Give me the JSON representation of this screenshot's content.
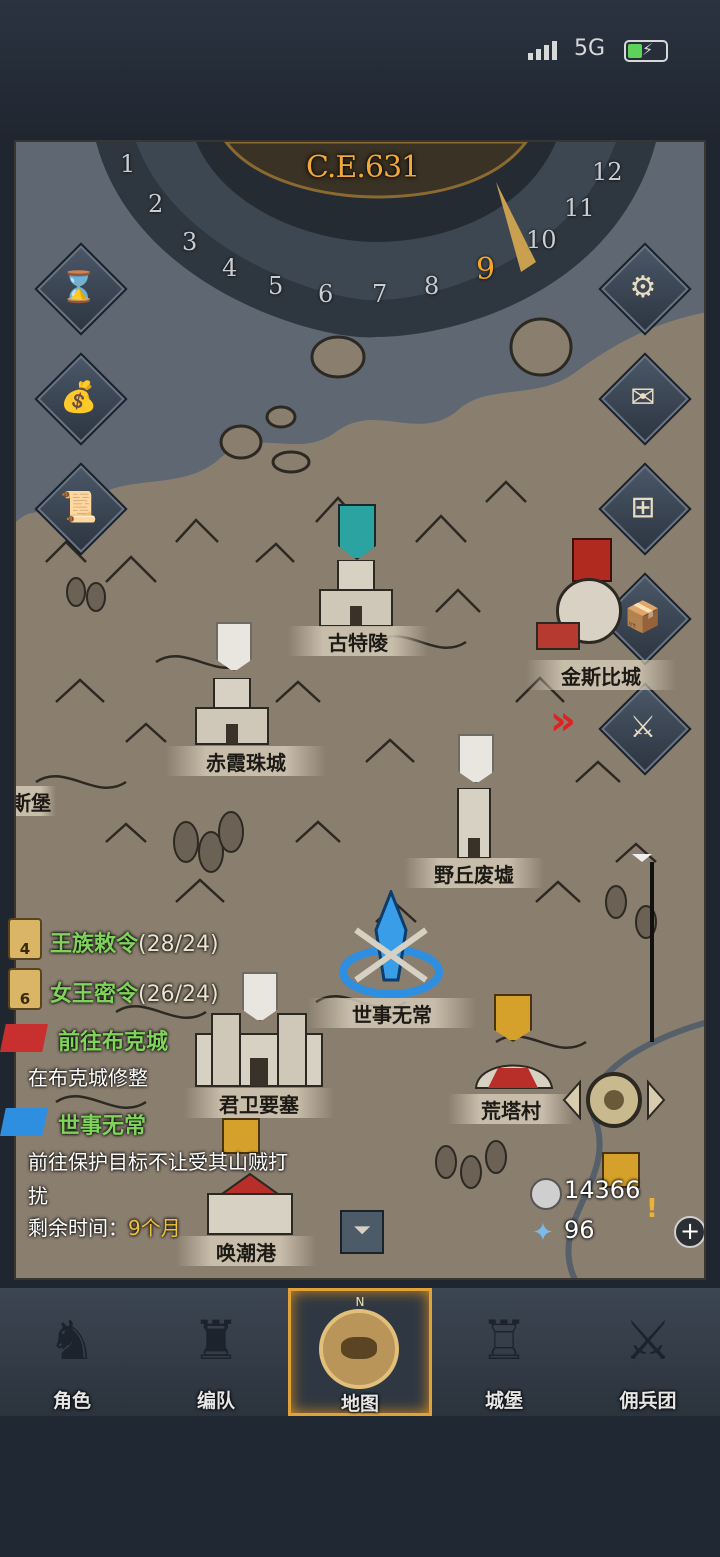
{
  "status_bar": {
    "network": "5G"
  },
  "calendar": {
    "year": "C.E.631",
    "months": [
      "1",
      "2",
      "3",
      "4",
      "5",
      "6",
      "7",
      "8",
      "9",
      "10",
      "11",
      "12"
    ],
    "current_month": "9"
  },
  "side_buttons_left": [
    {
      "icon": "hourglass-icon"
    },
    {
      "icon": "money-bag-icon"
    },
    {
      "icon": "scroll-map-icon"
    }
  ],
  "side_buttons_right": [
    {
      "icon": "gear-icon"
    },
    {
      "icon": "mail-icon"
    },
    {
      "icon": "window-icon"
    },
    {
      "icon": "supplies-icon"
    },
    {
      "icon": "helmet-sword-icon"
    }
  ],
  "locations": {
    "gutling": "古特陵",
    "jinsibi": "金斯比城",
    "chixia": "赤霞珠城",
    "yeqiu": "野丘废墟",
    "shishi": "世事无常",
    "junwei": "君卫要塞",
    "huangta": "荒塔村",
    "huanchao": "唤潮港",
    "partial_left": "斯堡"
  },
  "quests": [
    {
      "icon_number": "4",
      "title": "王族敕令",
      "count": "(28/24)"
    },
    {
      "icon_number": "6",
      "title": "女王密令",
      "count": "(26/24)"
    }
  ],
  "tasks": [
    {
      "title": "前往布克城",
      "desc": "在布克城修整"
    },
    {
      "title": "世事无常",
      "desc_line1": "前往保护目标不让受其山贼打",
      "desc_line2": "扰",
      "remaining_label": "剩余时间：",
      "remaining_value": "9个月"
    }
  ],
  "resources": {
    "silver": "14366",
    "crystal": "96"
  },
  "tabs": [
    {
      "label": "角色",
      "active": false
    },
    {
      "label": "编队",
      "active": false
    },
    {
      "label": "地图",
      "active": true,
      "compass": "N"
    },
    {
      "label": "城堡",
      "active": false
    },
    {
      "label": "佣兵团",
      "active": false
    }
  ],
  "colors": {
    "accent_gold": "#e2a23a",
    "quest_green": "#7fd35b",
    "year_orange": "#f1a93c",
    "selected_blue": "#2e8ee0"
  }
}
